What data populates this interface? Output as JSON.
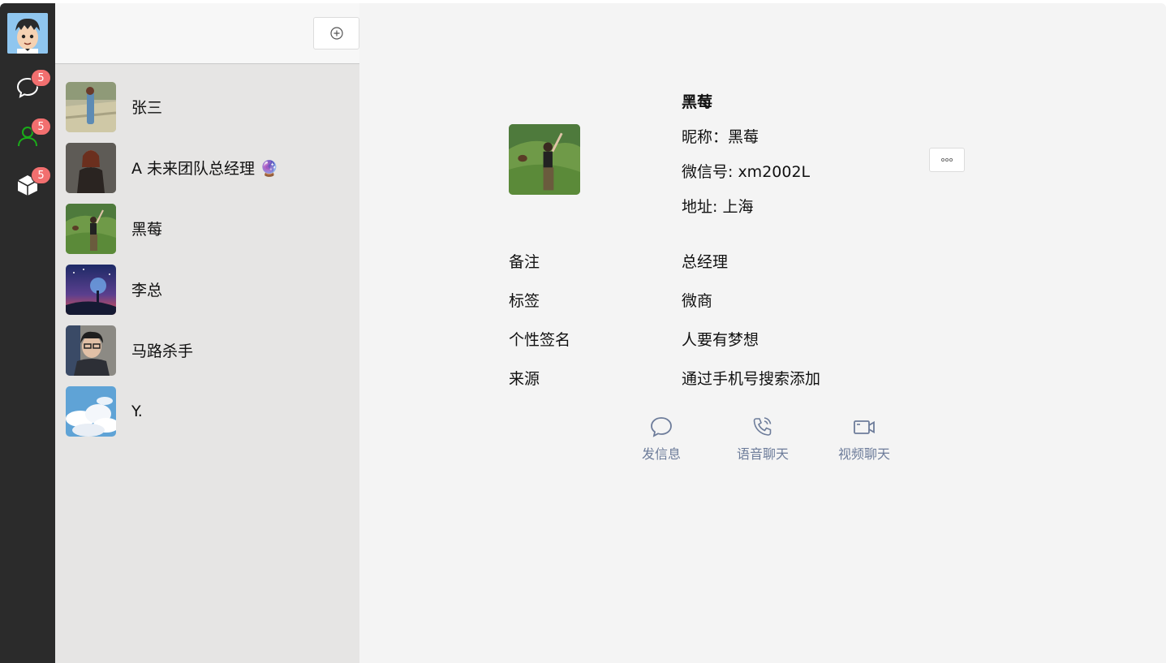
{
  "rail": {
    "chat_badge": "5",
    "contacts_badge": "5",
    "apps_badge": "5"
  },
  "contacts": [
    {
      "name": "张三",
      "avatar": "field-photo"
    },
    {
      "name": "A 未来团队总经理 🔮",
      "avatar": "woman-portrait"
    },
    {
      "name": "黑莓",
      "avatar": "hill-photo"
    },
    {
      "name": "李总",
      "avatar": "night-sky-photo"
    },
    {
      "name": "马路杀手",
      "avatar": "person-photo"
    },
    {
      "name": "Y.",
      "avatar": "clouds-photo"
    }
  ],
  "detail": {
    "name": "黑莓",
    "nickname": "昵称：黑莓",
    "wechat_id": "微信号: xm2002L",
    "address": "地址: 上海",
    "rows": [
      {
        "label": "备注",
        "value": "总经理"
      },
      {
        "label": "标签",
        "value": "微商"
      },
      {
        "label": "个性签名",
        "value": "人要有梦想"
      },
      {
        "label": "来源",
        "value": "通过手机号搜索添加"
      }
    ],
    "actions": {
      "message": "发信息",
      "voice": "语音聊天",
      "video": "视频聊天"
    }
  },
  "colors": {
    "rail": "#2b2b2b",
    "list_bg": "#e6e5e4",
    "detail_bg": "#f4f4f4",
    "badge": "#f26f6f",
    "active_icon": "#1aad19",
    "action_text": "#6d7c9a"
  }
}
